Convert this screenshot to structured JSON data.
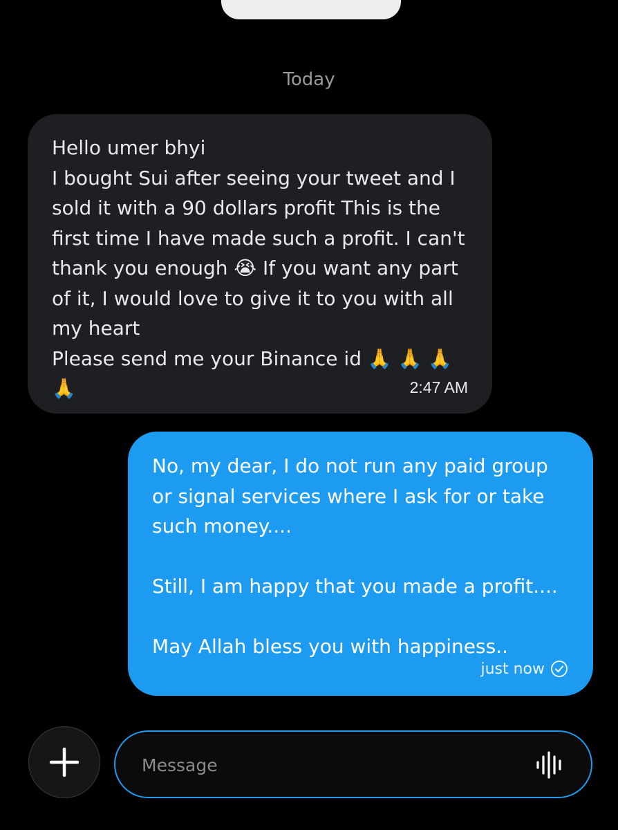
{
  "date_separator": "Today",
  "incoming_message": {
    "text": "Hello umer bhyi\nI bought Sui after seeing your tweet and I sold it with a 90 dollars profit This is the first time I have made such a profit. I can't thank you enough 😭 If you want any part of it, I would love to give it to you with all my heart\nPlease send me your Binance id 🙏 🙏 🙏\n🙏",
    "time": "2:47 AM"
  },
  "outgoing_message": {
    "text": "No, my dear, I do not run any paid group or signal services where I ask for or take such money....\n\nStill, I am happy that you made a profit....\n\nMay Allah bless you with happiness..",
    "time": "just now",
    "status_icon": "check-circle-icon"
  },
  "composer": {
    "placeholder": "Message",
    "add_icon": "plus-icon",
    "voice_icon": "voice-waveform-icon"
  },
  "colors": {
    "background": "#000000",
    "incoming_bubble": "#1d1f22",
    "outgoing_bubble": "#1d9bf0",
    "composer_border": "#1d9bf0"
  }
}
